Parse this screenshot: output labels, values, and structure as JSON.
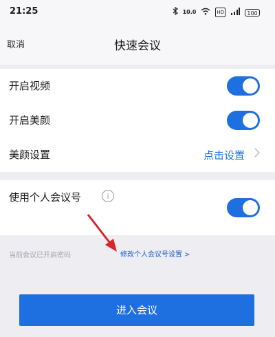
{
  "status_bar": {
    "time": "21:25",
    "bluetooth_icon": "bluetooth-icon",
    "speed": "10.0",
    "wifi_icon": "wifi-icon",
    "sim_label": "HD",
    "signal_icon": "signal-icon",
    "battery": "100"
  },
  "nav": {
    "cancel_label": "取消",
    "title": "快速会议"
  },
  "settings": {
    "video_label": "开启视频",
    "video_on": true,
    "beauty_label": "开启美颜",
    "beauty_on": true,
    "beauty_settings_label": "美颜设置",
    "beauty_settings_action": "点击设置",
    "personal_id_label": "使用个人会议号",
    "personal_id_on": true
  },
  "password_notice": "当前会议已开启密码",
  "modify_link": "修改个人会议号设置 >",
  "enter_button": "进入会议",
  "colors": {
    "accent": "#1e6fe0",
    "annotation_arrow": "#d8262a"
  }
}
